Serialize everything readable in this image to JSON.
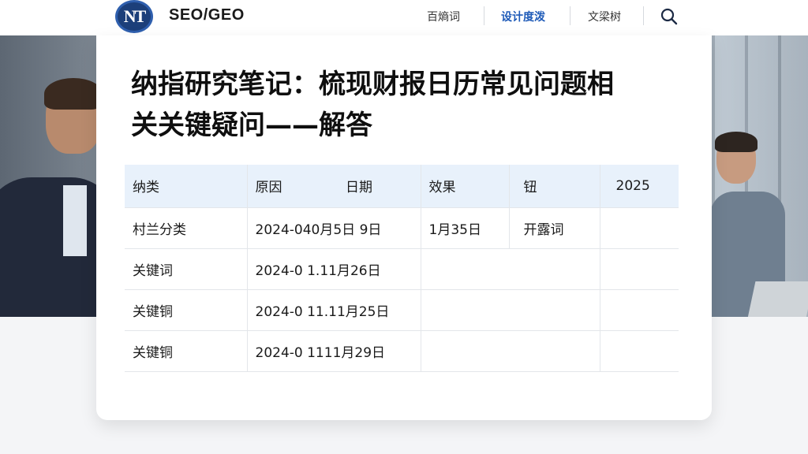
{
  "brand": {
    "logo_text": "NT",
    "name": "SEO/GEO"
  },
  "nav": {
    "items": [
      {
        "label": "百熵词",
        "active": false
      },
      {
        "label": "设计度泼",
        "active": true
      },
      {
        "label": "文梁树",
        "active": false
      }
    ],
    "search_icon": "search-icon"
  },
  "article": {
    "title_line1": "纳指研究笔记：梳现财报日历常见问题相",
    "title_line2": "关关键疑问——解答"
  },
  "table": {
    "headers": [
      "纳类",
      "原因",
      "日期",
      "效果",
      "钮",
      "2025"
    ],
    "rows": [
      [
        "村兰分类",
        "2024-040月5日 9日",
        "1月35日",
        "开露词",
        ""
      ],
      [
        "关键词",
        "2024-0 1.11月26日",
        "",
        "",
        ""
      ],
      [
        "关键铜",
        "2024-0 11.11月25日",
        "",
        "",
        ""
      ],
      [
        "关键铜",
        "2024-0 1111月29日",
        "",
        "",
        ""
      ]
    ]
  },
  "colors": {
    "accent": "#1f5bb8",
    "logo_bg": "#1c3f7a",
    "table_header_bg": "#e8f1fb"
  }
}
